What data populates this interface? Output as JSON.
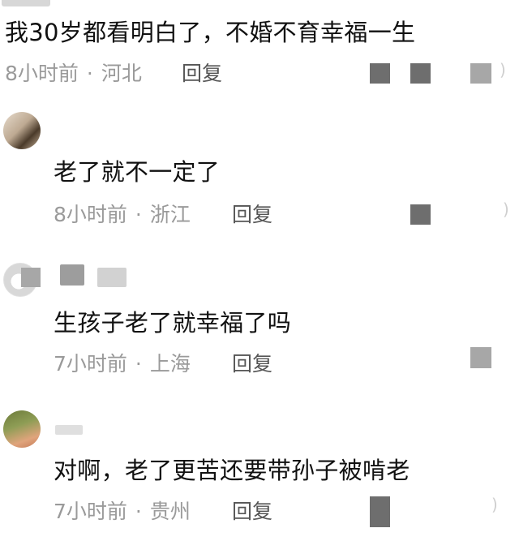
{
  "comments": [
    {
      "text": "我30岁都看明白了，不婚不育幸福一生",
      "time": "8小时前",
      "separator": "·",
      "location": "河北",
      "reply_label": "回复"
    },
    {
      "text": "老了就不一定了",
      "time": "8小时前",
      "separator": "·",
      "location": "浙江",
      "reply_label": "回复"
    },
    {
      "text": "生孩子老了就幸福了吗",
      "time": "7小时前",
      "separator": "·",
      "location": "上海",
      "reply_label": "回复"
    },
    {
      "text": "对啊，老了更苦还要带孙子被啃老",
      "time": "7小时前",
      "separator": "·",
      "location": "贵州",
      "reply_label": "回复"
    }
  ],
  "colors": {
    "main_text": "#111111",
    "meta_text": "#9a9a9a",
    "reply_text": "#555555",
    "background": "#ffffff"
  }
}
